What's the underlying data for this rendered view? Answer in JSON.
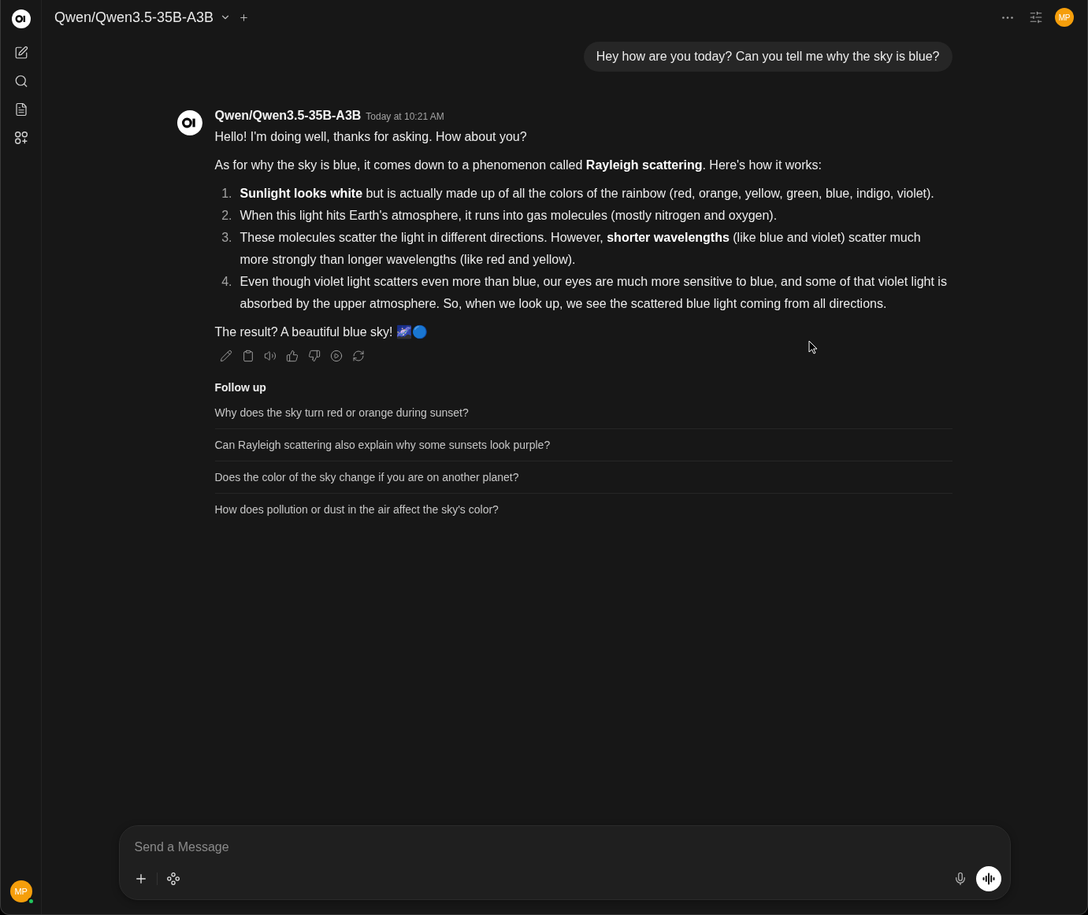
{
  "sidebar": {
    "avatar_initials": "MP",
    "online": true
  },
  "header": {
    "model": "Qwen/Qwen3.5-35B-A3B",
    "avatar_initials": "MP"
  },
  "messages": [
    {
      "kind": "user",
      "text": "Hey how are you today? Can you tell me why the sky is blue?"
    },
    {
      "kind": "assistant",
      "model": "Qwen/Qwen3.5-35B-A3B",
      "time": "Today at 10:21 AM",
      "blocks": [
        {
          "kind": "paragraph",
          "text": "Hello! I'm doing well, thanks for asking. How about you?"
        },
        {
          "kind": "paragraph",
          "text": "As for why the sky is blue, it comes down to a phenomenon called **Rayleigh scattering**. Here's how it works:"
        },
        {
          "kind": "list",
          "items": [
            {
              "number": "1.",
              "text": "**Sunlight looks white** but is actually made up of all the colors of the rainbow (red, orange, yellow, green, blue, indigo, violet)."
            },
            {
              "number": "2.",
              "text": "When this light hits Earth's atmosphere, it runs into gas molecules (mostly nitrogen and oxygen)."
            },
            {
              "number": "3.",
              "text": "These molecules scatter the light in different directions. However, **shorter wavelengths** (like blue and violet) scatter much more strongly than longer wavelengths (like red and yellow)."
            },
            {
              "number": "4.",
              "text": "Even though violet light scatters even more than blue, our eyes are much more sensitive to blue, and some of that violet light is absorbed by the upper atmosphere. So, when we look up, we see the scattered blue light coming from all directions."
            }
          ]
        },
        {
          "kind": "paragraph",
          "text": "The result? A beautiful blue sky! 🌌🔵"
        }
      ]
    }
  ],
  "follow_up": {
    "title": "Follow up",
    "items": [
      "Why does the sky turn red or orange during sunset?",
      "Can Rayleigh scattering also explain why some sunsets look purple?",
      "Does the color of the sky change if you are on another planet?",
      "How does pollution or dust in the air affect the sky's color?"
    ]
  },
  "composer": {
    "placeholder": "Send a Message"
  }
}
